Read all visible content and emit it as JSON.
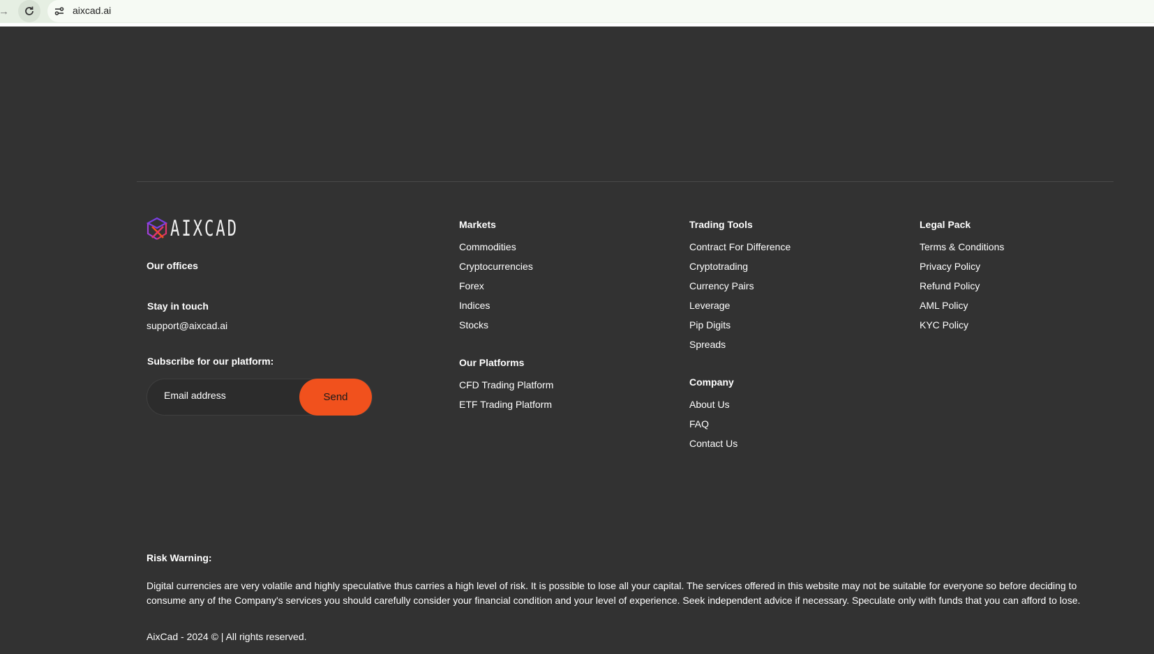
{
  "browser": {
    "url": "aixcad.ai"
  },
  "brand": {
    "name": "AIXCAD",
    "logo_colors": [
      "#7b3fe4",
      "#e0356b",
      "#f1511d"
    ]
  },
  "contact": {
    "offices_heading": "Our offices",
    "stay_heading": "Stay in touch",
    "email": "support@aixcad.ai",
    "subscribe_heading": "Subscribe for our platform:",
    "email_placeholder": "Email address",
    "send_label": "Send"
  },
  "markets": {
    "heading": "Markets",
    "items": [
      "Commodities",
      "Cryptocurrencies",
      "Forex",
      "Indices",
      "Stocks"
    ]
  },
  "platforms": {
    "heading": "Our Platforms",
    "items": [
      "CFD Trading Platform",
      "ETF Trading Platform"
    ]
  },
  "trading_tools": {
    "heading": "Trading Tools",
    "items": [
      "Contract For Difference",
      "Cryptotrading",
      "Currency Pairs",
      "Leverage",
      "Pip Digits",
      "Spreads"
    ]
  },
  "company": {
    "heading": "Company",
    "items": [
      "About Us",
      "FAQ",
      "Contact Us"
    ]
  },
  "legal": {
    "heading": "Legal Pack",
    "items": [
      "Terms & Conditions",
      "Privacy Policy",
      "Refund Policy",
      "AML Policy",
      "KYC Policy"
    ]
  },
  "risk": {
    "heading": "Risk Warning:",
    "text": "Digital currencies are very volatile and highly speculative thus carries a high level of risk. It is possible to lose all your capital. The services offered in this website may not be suitable for everyone so before deciding to consume any of the Company's services you should carefully consider your financial condition and your level of experience. Seek independent advice if necessary. Speculate only with funds that you can afford to lose."
  },
  "footer": {
    "copyright": "AixCad - 2024 © | All rights reserved."
  },
  "colors": {
    "background": "#323232",
    "accent": "#f1511d",
    "browser_bar": "#e6efe3"
  }
}
